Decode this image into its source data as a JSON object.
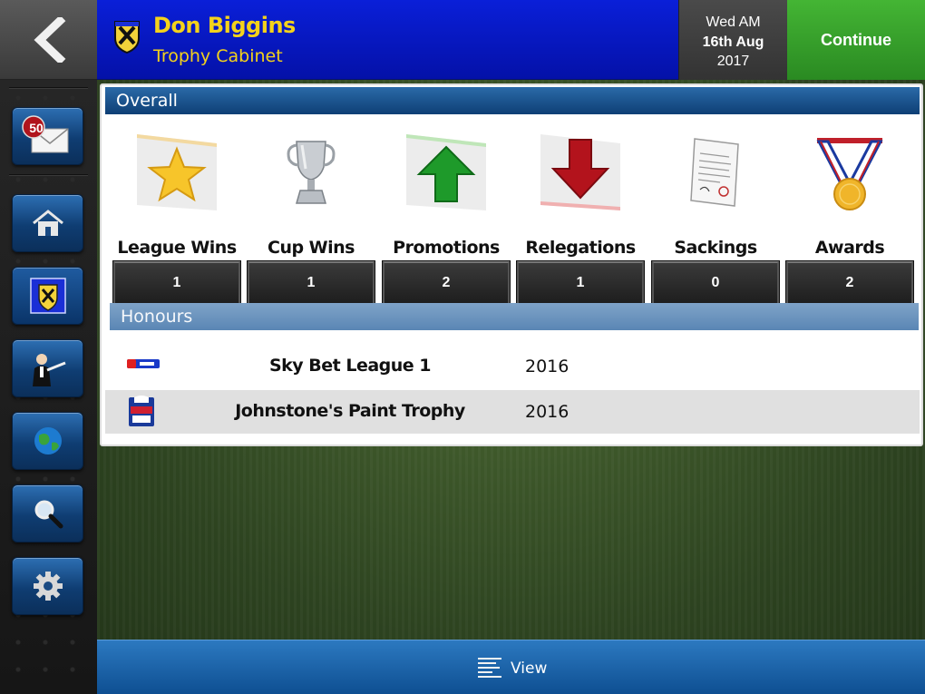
{
  "header": {
    "manager_name": "Don Biggins",
    "screen_title": "Trophy Cabinet",
    "date": {
      "day": "Wed AM",
      "date": "16th Aug",
      "year": "2017"
    },
    "continue_label": "Continue"
  },
  "sidebar": {
    "inbox_count": "50",
    "items": [
      {
        "name": "inbox",
        "icon": "envelope-icon"
      },
      {
        "name": "home",
        "icon": "home-icon"
      },
      {
        "name": "club",
        "icon": "club-crest-icon"
      },
      {
        "name": "manager",
        "icon": "manager-icon"
      },
      {
        "name": "world",
        "icon": "globe-icon"
      },
      {
        "name": "search",
        "icon": "magnifier-icon"
      },
      {
        "name": "settings",
        "icon": "gear-icon"
      }
    ]
  },
  "overall": {
    "title": "Overall",
    "stats": [
      {
        "label": "League Wins",
        "value": "1",
        "icon": "star-icon"
      },
      {
        "label": "Cup Wins",
        "value": "1",
        "icon": "trophy-icon"
      },
      {
        "label": "Promotions",
        "value": "2",
        "icon": "up-arrow-icon"
      },
      {
        "label": "Relegations",
        "value": "1",
        "icon": "down-arrow-icon"
      },
      {
        "label": "Sackings",
        "value": "0",
        "icon": "document-icon"
      },
      {
        "label": "Awards",
        "value": "2",
        "icon": "medal-icon"
      }
    ]
  },
  "honours": {
    "title": "Honours",
    "rows": [
      {
        "competition": "Sky Bet League 1",
        "year": "2016",
        "logo": "sky-bet-logo"
      },
      {
        "competition": "Johnstone's Paint Trophy",
        "year": "2016",
        "logo": "johnstones-paint-logo"
      }
    ]
  },
  "bottom_bar": {
    "view_label": "View"
  },
  "colors": {
    "header_blue": "#0411a8",
    "name_yellow": "#f4d21b",
    "continue_green": "#2a8a22",
    "section_blue": "#0e3f75",
    "honours_blue": "#5a86b4"
  }
}
